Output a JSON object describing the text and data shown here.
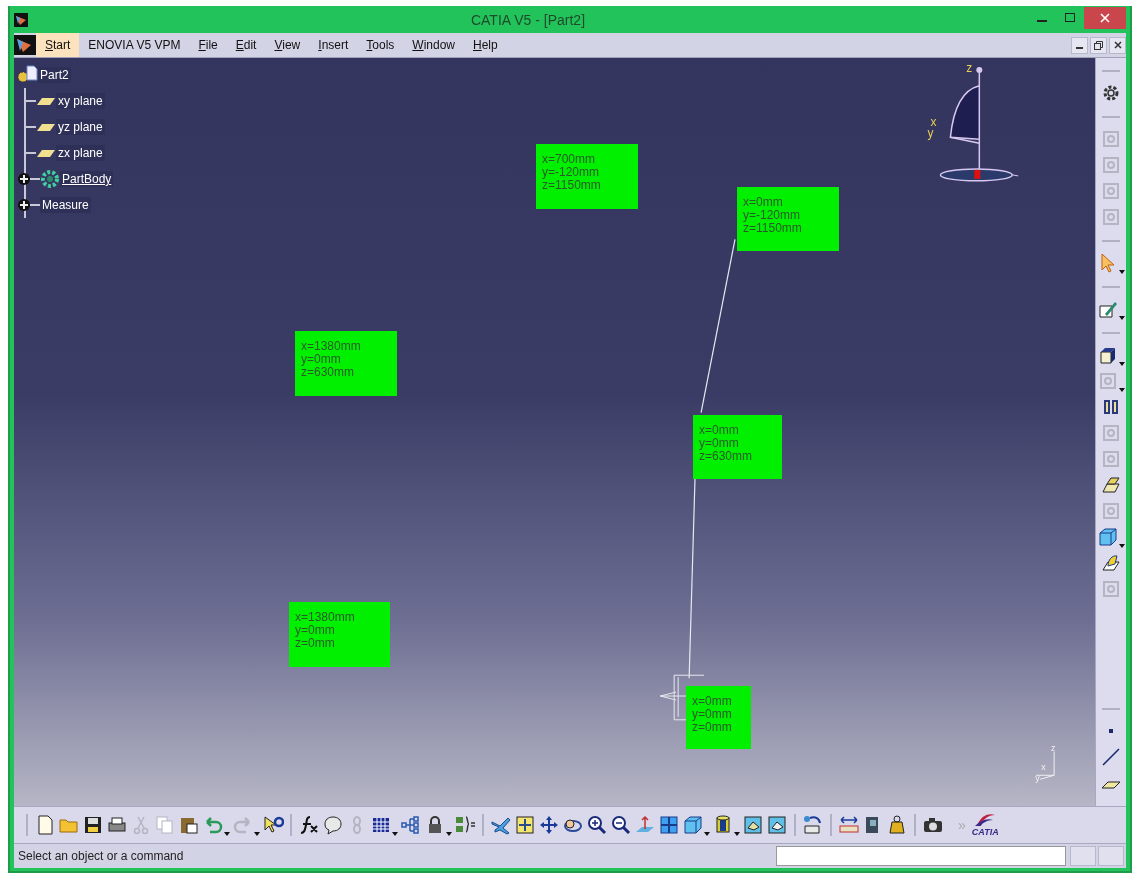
{
  "window": {
    "title": "CATIA V5 - [Part2]"
  },
  "menu": [
    {
      "label": "Start",
      "selected": true,
      "mnemonic": true
    },
    {
      "label": "ENOVIA V5 VPM",
      "selected": false,
      "mnemonic": false
    },
    {
      "label": "File",
      "selected": false,
      "mnemonic": true
    },
    {
      "label": "Edit",
      "selected": false,
      "mnemonic": true
    },
    {
      "label": "View",
      "selected": false,
      "mnemonic": true
    },
    {
      "label": "Insert",
      "selected": false,
      "mnemonic": true
    },
    {
      "label": "Tools",
      "selected": false,
      "mnemonic": true
    },
    {
      "label": "Window",
      "selected": false,
      "mnemonic": true
    },
    {
      "label": "Help",
      "selected": false,
      "mnemonic": true
    }
  ],
  "tree": {
    "label": "Part2",
    "kind": "part",
    "children": [
      {
        "label": "xy plane",
        "kind": "plane",
        "current": false
      },
      {
        "label": "yz plane",
        "kind": "plane",
        "current": false
      },
      {
        "label": "zx plane",
        "kind": "plane",
        "current": false
      },
      {
        "label": "PartBody",
        "kind": "body",
        "current": true,
        "expanded": false
      },
      {
        "label": "Measure",
        "kind": "measure",
        "current": false,
        "expanded": false
      }
    ]
  },
  "viewport": {
    "labels": [
      {
        "lines": [
          "x=700mm",
          "y=-120mm",
          "z=1150mm"
        ]
      },
      {
        "lines": [
          "x=0mm",
          "y=-120mm",
          "z=1150mm"
        ]
      },
      {
        "lines": [
          "x=1380mm",
          "y=0mm",
          "z=630mm"
        ]
      },
      {
        "lines": [
          "x=0mm",
          "y=0mm",
          "z=630mm"
        ]
      },
      {
        "lines": [
          "x=1380mm",
          "y=0mm",
          "z=0mm"
        ]
      },
      {
        "lines": [
          "x=0mm",
          "y=0mm",
          "z=0mm"
        ]
      }
    ],
    "compass": {
      "axes": [
        "z",
        "x",
        "y"
      ]
    },
    "axis_triad": {
      "axes": [
        "z",
        "x",
        "y"
      ]
    }
  },
  "right_toolbar": [
    [
      {
        "kind": "gear",
        "disabled": false
      }
    ],
    [
      {
        "kind": "product",
        "disabled": true
      },
      {
        "kind": "product",
        "disabled": true
      },
      {
        "kind": "product",
        "disabled": true
      },
      {
        "kind": "product",
        "disabled": true
      }
    ],
    [
      {
        "kind": "pointer",
        "disabled": false,
        "dropdown": true
      }
    ],
    [
      {
        "kind": "sketch",
        "disabled": false,
        "dropdown": true
      }
    ],
    [
      {
        "kind": "pad",
        "disabled": false,
        "dropdown": true
      },
      {
        "kind": "pocket",
        "disabled": true,
        "dropdown": true
      },
      {
        "kind": "shaft",
        "disabled": false
      },
      {
        "kind": "groove",
        "disabled": true
      },
      {
        "kind": "hole",
        "disabled": true
      },
      {
        "kind": "rib",
        "disabled": false
      },
      {
        "kind": "slot",
        "disabled": true
      },
      {
        "kind": "cube",
        "disabled": false,
        "dropdown": true
      },
      {
        "kind": "loft",
        "disabled": false
      },
      {
        "kind": "stiffener",
        "disabled": true
      }
    ],
    [
      {
        "kind": "point",
        "disabled": false
      },
      {
        "kind": "line",
        "disabled": false
      },
      {
        "kind": "plane",
        "disabled": false
      }
    ]
  ],
  "bottom_toolbar": [
    [
      {
        "kind": "doc",
        "disabled": false
      },
      {
        "kind": "folder",
        "disabled": false
      },
      {
        "kind": "disk",
        "disabled": false
      },
      {
        "kind": "printer",
        "disabled": false
      },
      {
        "kind": "scissors",
        "disabled": true
      },
      {
        "kind": "copy",
        "disabled": true
      },
      {
        "kind": "clipboard",
        "disabled": false
      },
      {
        "kind": "undo",
        "disabled": false,
        "dropdown": true
      },
      {
        "kind": "redo",
        "disabled": true,
        "dropdown": true
      },
      {
        "kind": "help",
        "disabled": false
      }
    ],
    [
      {
        "kind": "fx",
        "disabled": false
      },
      {
        "kind": "bubble",
        "disabled": false
      },
      {
        "kind": "chain",
        "disabled": true
      },
      {
        "kind": "grid",
        "disabled": false,
        "dropdown": true
      },
      {
        "kind": "tree",
        "disabled": false
      },
      {
        "kind": "lock",
        "disabled": false,
        "dropdown": true
      },
      {
        "kind": "brace",
        "disabled": false
      }
    ],
    [
      {
        "kind": "fly",
        "disabled": false
      },
      {
        "kind": "fit",
        "disabled": false
      },
      {
        "kind": "move",
        "disabled": false
      },
      {
        "kind": "rotate",
        "disabled": false
      },
      {
        "kind": "zoomin",
        "disabled": false
      },
      {
        "kind": "zoomout",
        "disabled": false
      },
      {
        "kind": "normal",
        "disabled": false
      },
      {
        "kind": "quad",
        "disabled": false
      },
      {
        "kind": "cube",
        "disabled": false,
        "dropdown": true
      },
      {
        "kind": "cylinder",
        "disabled": false,
        "dropdown": true
      },
      {
        "kind": "pic",
        "disabled": false
      },
      {
        "kind": "pic2",
        "disabled": false
      }
    ],
    [
      {
        "kind": "boxarrow",
        "disabled": false
      }
    ],
    [
      {
        "kind": "ruler",
        "disabled": false
      },
      {
        "kind": "clamp",
        "disabled": false
      },
      {
        "kind": "weight",
        "disabled": false
      }
    ],
    [
      {
        "kind": "camera",
        "disabled": false
      }
    ]
  ],
  "overflow_glyph": "»",
  "logo": {
    "text": "CATIA"
  },
  "status_bar": {
    "message": "Select an object or a command"
  }
}
